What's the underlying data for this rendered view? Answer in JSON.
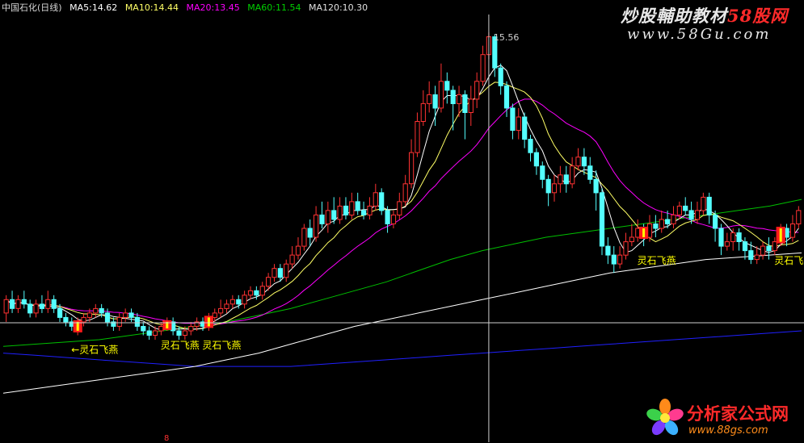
{
  "header": {
    "stock_name": "中国石化(日线)",
    "ma5": "MA5:14.62",
    "ma10": "MA10:14.44",
    "ma20": "MA20:13.45",
    "ma60": "MA60:11.54",
    "ma120": "MA120:10.30"
  },
  "watermark": {
    "top_line": "炒股輔助教材",
    "top_brand": "58股网",
    "url_top": "www.58Gu.com",
    "bottom_brand": "分析家公式网",
    "url_bottom": "www.88gs.com"
  },
  "colors": {
    "up": "#ff3232",
    "down": "#54ffff",
    "ma5": "#ffffff",
    "ma10": "#ffff66",
    "ma20": "#ff00ff",
    "ma60": "#00c000",
    "ma120": "#ffffff",
    "ma250": "#2020ff",
    "signal": "#ffff00"
  },
  "chart_data": {
    "type": "candlestick",
    "price_range": [
      6.4,
      16.0
    ],
    "peak_label": "15.56",
    "bottom_marker": "8",
    "signals": [
      {
        "index": 12,
        "text": "←灵石飞燕"
      },
      {
        "index": 27,
        "text": "灵石飞燕"
      },
      {
        "index": 34,
        "text": "灵石飞燕"
      },
      {
        "index": 107,
        "text": "灵石飞燕"
      },
      {
        "index": 130,
        "text": "灵石飞燕"
      }
    ],
    "candles": [
      [
        9.3,
        9.6,
        9.7,
        9.1
      ],
      [
        9.6,
        9.4,
        9.8,
        9.3
      ],
      [
        9.4,
        9.6,
        9.7,
        9.3
      ],
      [
        9.6,
        9.5,
        9.8,
        9.4
      ],
      [
        9.5,
        9.3,
        9.6,
        9.2
      ],
      [
        9.3,
        9.5,
        9.6,
        9.2
      ],
      [
        9.5,
        9.4,
        9.7,
        9.3
      ],
      [
        9.4,
        9.6,
        9.8,
        9.3
      ],
      [
        9.6,
        9.4,
        9.7,
        9.3
      ],
      [
        9.4,
        9.2,
        9.5,
        9.1
      ],
      [
        9.2,
        9.1,
        9.3,
        9.0
      ],
      [
        9.1,
        9.0,
        9.2,
        8.9
      ],
      [
        8.9,
        9.1,
        9.2,
        8.8
      ],
      [
        9.1,
        9.2,
        9.3,
        9.0
      ],
      [
        9.2,
        9.3,
        9.4,
        9.1
      ],
      [
        9.3,
        9.4,
        9.5,
        9.2
      ],
      [
        9.4,
        9.3,
        9.5,
        9.2
      ],
      [
        9.3,
        9.1,
        9.4,
        9.0
      ],
      [
        9.1,
        9.0,
        9.2,
        8.9
      ],
      [
        9.0,
        9.2,
        9.3,
        8.9
      ],
      [
        9.2,
        9.3,
        9.4,
        9.1
      ],
      [
        9.3,
        9.2,
        9.4,
        9.1
      ],
      [
        9.2,
        9.0,
        9.3,
        8.9
      ],
      [
        9.0,
        8.9,
        9.1,
        8.8
      ],
      [
        8.9,
        8.8,
        9.0,
        8.7
      ],
      [
        8.8,
        8.9,
        9.0,
        8.7
      ],
      [
        8.9,
        9.0,
        9.1,
        8.8
      ],
      [
        9.0,
        9.1,
        9.2,
        8.9
      ],
      [
        9.1,
        8.9,
        9.2,
        8.8
      ],
      [
        8.9,
        8.8,
        9.0,
        8.7
      ],
      [
        8.8,
        8.9,
        9.0,
        8.7
      ],
      [
        8.9,
        9.0,
        9.1,
        8.8
      ],
      [
        9.0,
        9.1,
        9.2,
        8.9
      ],
      [
        9.1,
        9.0,
        9.2,
        8.9
      ],
      [
        9.0,
        9.2,
        9.3,
        8.9
      ],
      [
        9.2,
        9.3,
        9.4,
        9.1
      ],
      [
        9.3,
        9.4,
        9.6,
        9.2
      ],
      [
        9.4,
        9.5,
        9.6,
        9.3
      ],
      [
        9.5,
        9.6,
        9.7,
        9.4
      ],
      [
        9.6,
        9.5,
        9.7,
        9.4
      ],
      [
        9.5,
        9.7,
        9.8,
        9.4
      ],
      [
        9.7,
        9.8,
        9.9,
        9.6
      ],
      [
        9.8,
        9.7,
        9.9,
        9.6
      ],
      [
        9.7,
        9.9,
        10.0,
        9.6
      ],
      [
        9.9,
        10.1,
        10.2,
        9.8
      ],
      [
        10.1,
        10.3,
        10.4,
        10.0
      ],
      [
        10.3,
        10.1,
        10.4,
        10.0
      ],
      [
        10.1,
        10.4,
        10.5,
        10.0
      ],
      [
        10.4,
        10.6,
        10.8,
        10.3
      ],
      [
        10.6,
        10.8,
        11.0,
        10.5
      ],
      [
        10.8,
        11.2,
        11.3,
        10.7
      ],
      [
        11.2,
        11.0,
        11.4,
        10.8
      ],
      [
        11.0,
        11.5,
        11.7,
        10.9
      ],
      [
        11.5,
        11.3,
        11.8,
        11.2
      ],
      [
        11.3,
        11.6,
        11.8,
        11.1
      ],
      [
        11.6,
        11.4,
        11.9,
        11.3
      ],
      [
        11.4,
        11.7,
        11.9,
        11.3
      ],
      [
        11.7,
        11.5,
        11.9,
        11.4
      ],
      [
        11.5,
        11.8,
        12.0,
        11.4
      ],
      [
        11.8,
        11.6,
        12.0,
        11.5
      ],
      [
        11.6,
        11.5,
        11.8,
        11.4
      ],
      [
        11.5,
        11.7,
        11.9,
        11.4
      ],
      [
        11.7,
        12.0,
        12.2,
        11.6
      ],
      [
        12.0,
        11.6,
        12.1,
        11.5
      ],
      [
        11.6,
        11.3,
        11.7,
        11.1
      ],
      [
        11.3,
        11.5,
        11.6,
        11.2
      ],
      [
        11.5,
        11.8,
        12.0,
        11.4
      ],
      [
        11.8,
        12.2,
        12.4,
        11.7
      ],
      [
        12.2,
        12.9,
        13.2,
        12.1
      ],
      [
        12.9,
        13.6,
        13.8,
        12.8
      ],
      [
        13.6,
        14.0,
        14.3,
        13.5
      ],
      [
        14.0,
        14.2,
        14.5,
        13.8
      ],
      [
        14.2,
        13.9,
        14.4,
        13.5
      ],
      [
        13.9,
        14.5,
        14.9,
        13.8
      ],
      [
        14.5,
        14.3,
        14.7,
        14.0
      ],
      [
        14.3,
        14.0,
        14.4,
        13.4
      ],
      [
        14.0,
        14.2,
        14.4,
        13.7
      ],
      [
        14.2,
        13.8,
        14.3,
        13.2
      ],
      [
        13.8,
        14.1,
        14.4,
        13.5
      ],
      [
        14.1,
        14.5,
        14.7,
        13.9
      ],
      [
        14.5,
        15.1,
        15.3,
        14.4
      ],
      [
        15.1,
        15.5,
        15.6,
        15.0
      ],
      [
        15.5,
        14.8,
        15.56,
        14.6
      ],
      [
        14.8,
        14.4,
        14.9,
        14.2
      ],
      [
        14.4,
        13.9,
        14.5,
        13.7
      ],
      [
        13.9,
        13.4,
        14.0,
        13.2
      ],
      [
        13.4,
        13.7,
        13.9,
        13.2
      ],
      [
        13.7,
        13.2,
        13.8,
        13.0
      ],
      [
        13.2,
        12.9,
        13.3,
        12.7
      ],
      [
        12.9,
        12.6,
        13.0,
        12.4
      ],
      [
        12.6,
        12.3,
        12.7,
        12.1
      ],
      [
        12.3,
        12.0,
        12.4,
        11.7
      ],
      [
        12.0,
        12.2,
        12.4,
        11.8
      ],
      [
        12.2,
        12.4,
        12.6,
        12.0
      ],
      [
        12.4,
        12.2,
        12.6,
        12.0
      ],
      [
        12.2,
        12.6,
        12.8,
        12.1
      ],
      [
        12.6,
        12.8,
        13.0,
        12.5
      ],
      [
        12.8,
        12.6,
        13.0,
        12.4
      ],
      [
        12.6,
        12.3,
        12.8,
        12.2
      ],
      [
        12.3,
        12.0,
        12.5,
        11.6
      ],
      [
        12.0,
        10.8,
        12.1,
        10.6
      ],
      [
        10.8,
        10.6,
        11.0,
        10.4
      ],
      [
        10.6,
        10.4,
        10.8,
        10.2
      ],
      [
        10.4,
        10.6,
        10.8,
        10.3
      ],
      [
        10.6,
        10.9,
        11.1,
        10.5
      ],
      [
        10.9,
        11.0,
        11.3,
        10.8
      ],
      [
        11.0,
        11.2,
        11.4,
        10.9
      ],
      [
        11.2,
        11.0,
        11.3,
        10.8
      ],
      [
        11.0,
        11.3,
        11.5,
        10.9
      ],
      [
        11.3,
        11.2,
        11.5,
        11.0
      ],
      [
        11.2,
        11.4,
        11.6,
        11.1
      ],
      [
        11.4,
        11.3,
        11.6,
        11.2
      ],
      [
        11.3,
        11.5,
        11.7,
        11.2
      ],
      [
        11.5,
        11.7,
        11.8,
        11.4
      ],
      [
        11.7,
        11.6,
        11.9,
        11.5
      ],
      [
        11.6,
        11.4,
        11.8,
        11.3
      ],
      [
        11.4,
        11.6,
        11.8,
        11.3
      ],
      [
        11.6,
        11.9,
        12.0,
        11.5
      ],
      [
        11.9,
        11.5,
        12.0,
        11.3
      ],
      [
        11.5,
        11.2,
        11.6,
        10.9
      ],
      [
        11.2,
        10.8,
        11.3,
        10.6
      ],
      [
        10.8,
        10.9,
        11.1,
        10.7
      ],
      [
        10.9,
        11.1,
        11.2,
        10.7
      ],
      [
        11.1,
        10.9,
        11.2,
        10.7
      ],
      [
        10.9,
        10.7,
        11.0,
        10.5
      ],
      [
        10.7,
        10.5,
        10.9,
        10.4
      ],
      [
        10.5,
        10.6,
        10.8,
        10.4
      ],
      [
        10.6,
        10.8,
        10.9,
        10.5
      ],
      [
        10.8,
        10.7,
        11.0,
        10.5
      ],
      [
        10.7,
        10.9,
        11.0,
        10.6
      ],
      [
        10.9,
        11.2,
        11.3,
        10.8
      ],
      [
        11.2,
        11.0,
        11.3,
        10.8
      ],
      [
        11.0,
        11.3,
        11.5,
        10.9
      ],
      [
        11.3,
        11.6,
        11.7,
        11.2
      ]
    ],
    "ma60_approx": [
      8.55,
      8.6,
      8.65,
      8.7,
      8.8,
      8.9,
      9.0,
      9.1,
      9.25,
      9.4,
      9.6,
      9.8,
      10.0,
      10.25,
      10.5,
      10.7,
      10.85,
      11.0,
      11.1,
      11.2,
      11.3,
      11.4,
      11.5,
      11.6,
      11.7,
      11.85
    ],
    "ma120_approx": [
      7.5,
      7.6,
      7.7,
      7.8,
      7.9,
      8.0,
      8.1,
      8.25,
      8.4,
      8.6,
      8.8,
      9.0,
      9.15,
      9.3,
      9.45,
      9.6,
      9.75,
      9.9,
      10.05,
      10.2,
      10.3,
      10.4,
      10.5,
      10.55,
      10.6,
      10.65
    ],
    "ma250_approx": [
      8.4,
      8.35,
      8.3,
      8.25,
      8.2,
      8.15,
      8.1,
      8.1,
      8.1,
      8.1,
      8.15,
      8.2,
      8.25,
      8.3,
      8.35,
      8.4,
      8.45,
      8.5,
      8.55,
      8.6,
      8.65,
      8.7,
      8.75,
      8.8,
      8.85,
      8.9
    ]
  }
}
